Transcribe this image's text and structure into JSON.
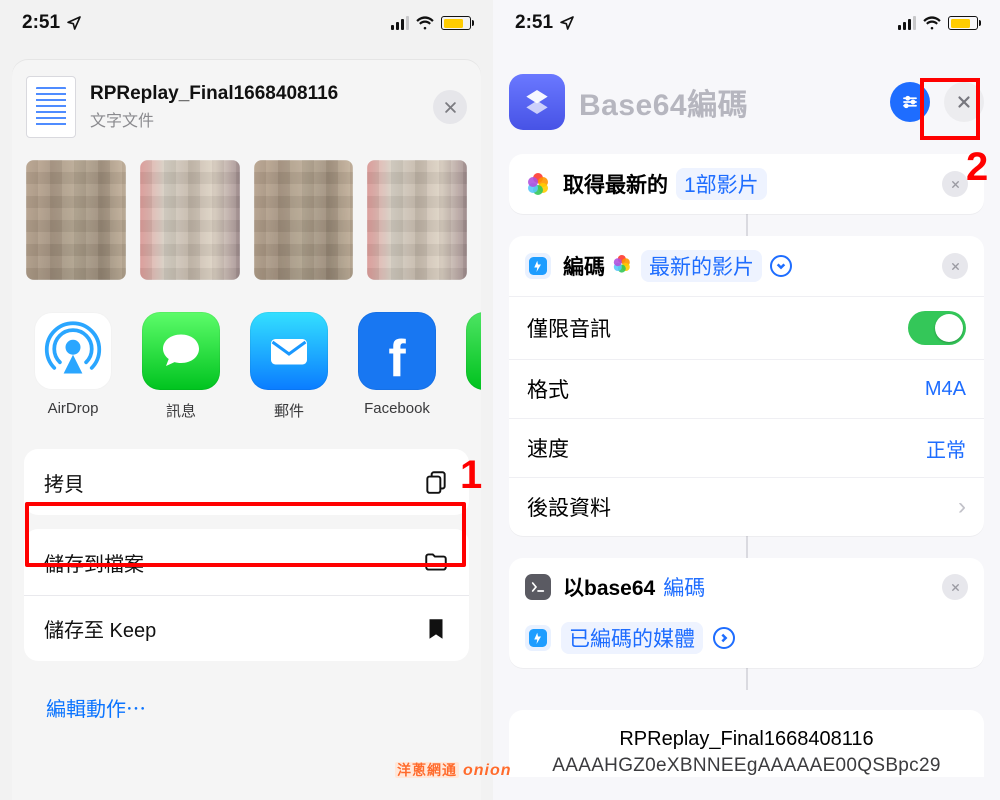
{
  "status": {
    "time": "2:51"
  },
  "left": {
    "file": {
      "name": "RPReplay_Final1668408116",
      "type": "文字文件"
    },
    "apps": [
      {
        "id": "airdrop",
        "label": "AirDrop"
      },
      {
        "id": "messages",
        "label": "訊息"
      },
      {
        "id": "mail",
        "label": "郵件"
      },
      {
        "id": "facebook",
        "label": "Facebook"
      }
    ],
    "actions": {
      "copy": "拷貝",
      "files": "儲存到檔案",
      "keep": "儲存至 Keep",
      "edit": "編輯動作⋯"
    },
    "annotation_number": "1"
  },
  "right": {
    "title": "Base64編碼",
    "card_get": {
      "prefix": "取得最新的",
      "link": "1部影片"
    },
    "card_encode": {
      "label": "編碼",
      "link": "最新的影片",
      "options": {
        "audio_only": {
          "label": "僅限音訊",
          "on": true
        },
        "format": {
          "label": "格式",
          "value": "M4A"
        },
        "speed": {
          "label": "速度",
          "value": "正常"
        },
        "metadata": {
          "label": "後設資料"
        }
      }
    },
    "card_b64": {
      "prefix": "以base64",
      "link": "編碼",
      "sub_link": "已編碼的媒體"
    },
    "result": {
      "name": "RPReplay_Final1668408116",
      "encoded": "AAAAHGZ0eXBNNEEgAAAAAE00QSBpc29"
    },
    "annotation_number": "2"
  },
  "watermark": {
    "cn": "洋蔥網通",
    "en": "onion"
  }
}
